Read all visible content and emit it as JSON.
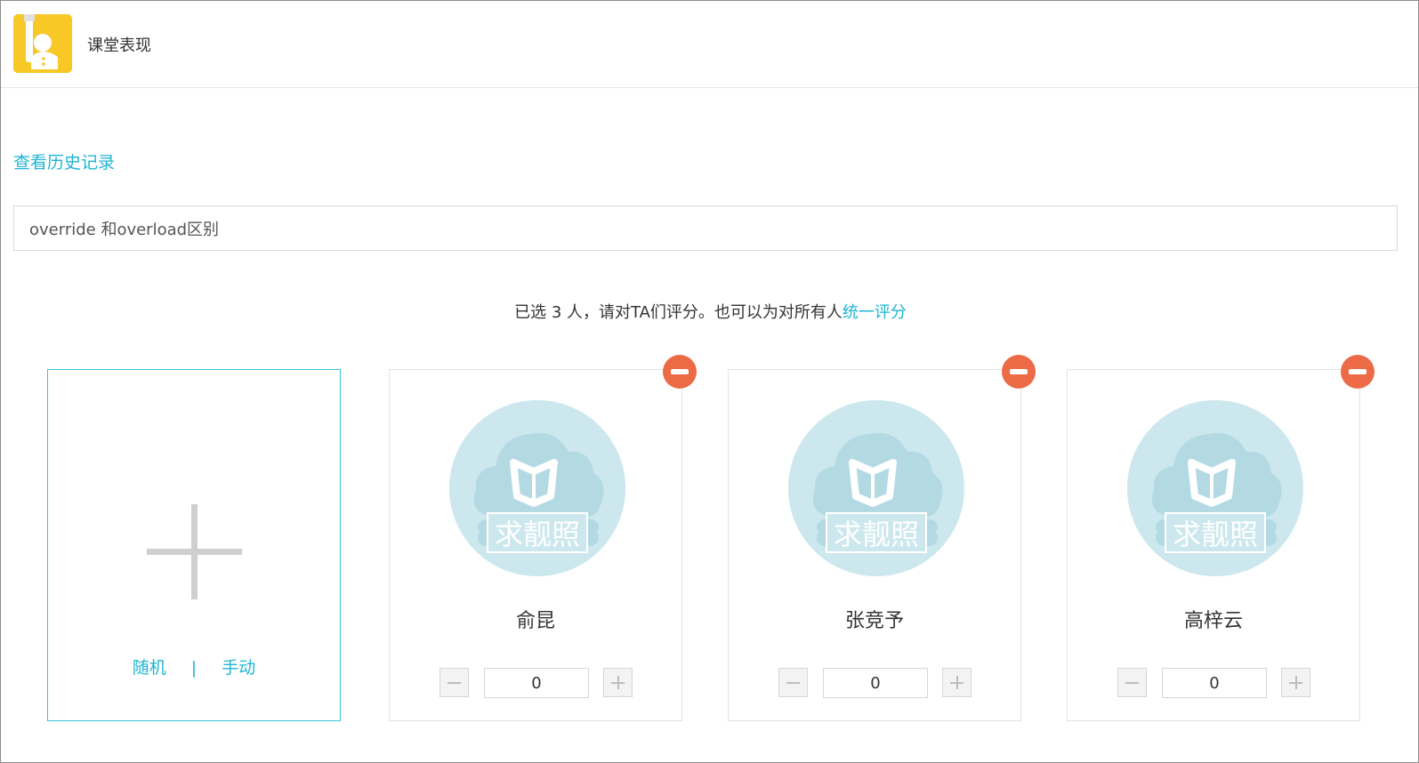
{
  "header": {
    "title": "课堂表现",
    "icon": "classroom-app-icon",
    "icon_color": "#f7c826"
  },
  "history_link": "查看历史记录",
  "topic": {
    "value": "override 和overload区别"
  },
  "status": {
    "prefix": "已选 3 人，请对TA们评分。也可以为对所有人",
    "link": "统一评分"
  },
  "add_card": {
    "random_label": "随机",
    "separator": "|",
    "manual_label": "手动"
  },
  "avatar_placeholder_text": "求靓照",
  "students": [
    {
      "name": "俞昆",
      "score": "0"
    },
    {
      "name": "张竞予",
      "score": "0"
    },
    {
      "name": "高梓云",
      "score": "0"
    }
  ],
  "colors": {
    "accent": "#1fb5d4",
    "remove": "#ec6a45",
    "avatar_bg": "#cce8ee"
  }
}
